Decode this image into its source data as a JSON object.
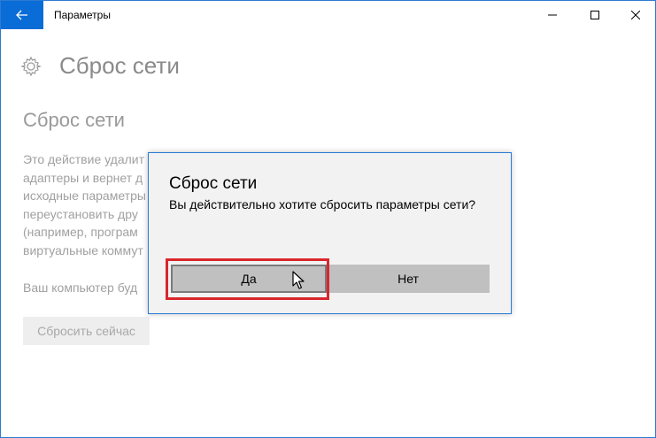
{
  "window": {
    "title": "Параметры",
    "icons": {
      "back": "back-arrow-icon",
      "minimize": "minimize-icon",
      "maximize": "maximize-icon",
      "close": "close-icon"
    }
  },
  "page": {
    "header_icon": "gear-icon",
    "header_title": "Сброс сети",
    "section_title": "Сброс сети",
    "description_lines": [
      "Это действие удалит",
      "адаптеры и вернет д",
      "исходные параметры",
      "переустановить дру",
      "(например, програм",
      "виртуальные коммут"
    ],
    "note": "Ваш компьютер буд",
    "reset_now_button": "Сбросить сейчас"
  },
  "dialog": {
    "title": "Сброс сети",
    "message": "Вы действительно хотите сбросить параметры сети?",
    "yes_label": "Да",
    "no_label": "Нет"
  },
  "colors": {
    "accent": "#0a6cd6",
    "highlight": "#d9262b",
    "disabled_text": "#a0a0a0"
  }
}
